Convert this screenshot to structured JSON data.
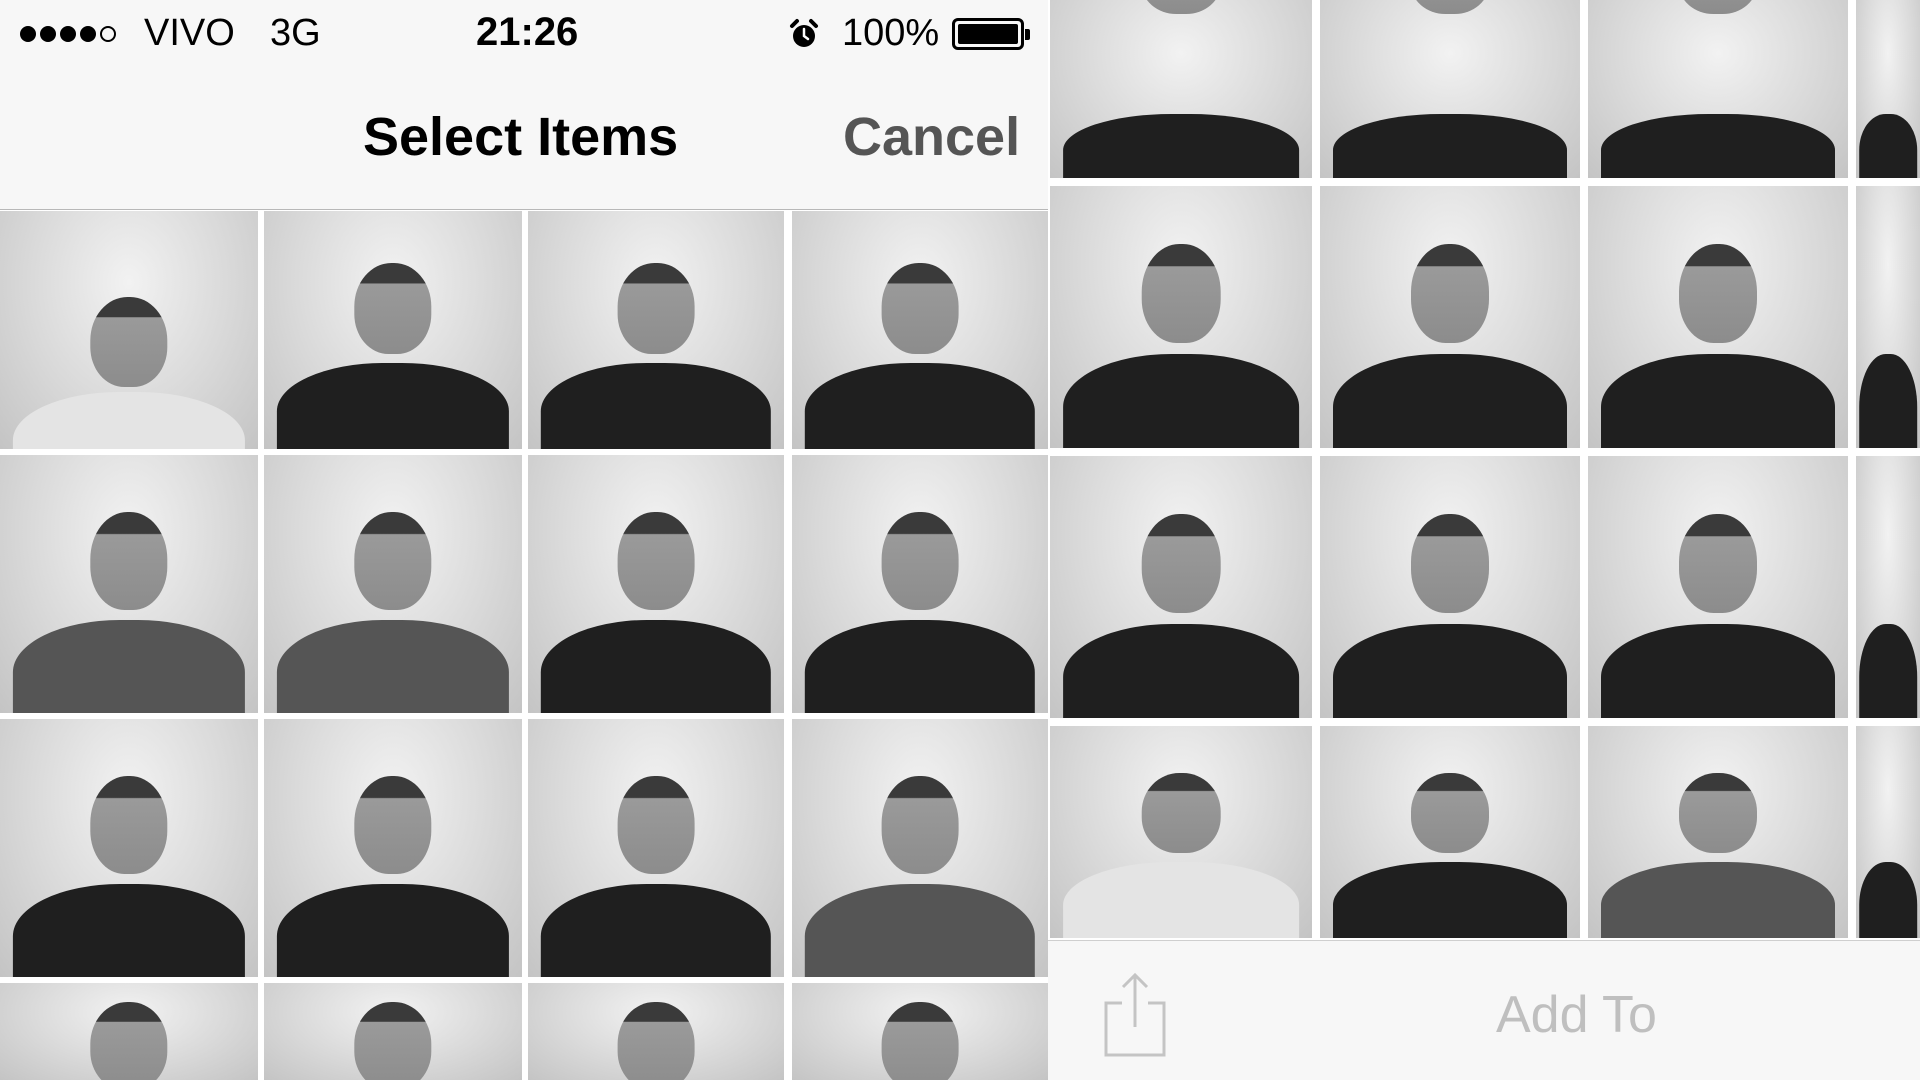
{
  "status_bar": {
    "signal_bars": 4,
    "signal_max": 5,
    "carrier": "VIVO",
    "network": "3G",
    "time": "21:26",
    "alarm_icon": "alarm-clock-icon",
    "battery_percent": "100%",
    "battery_level": 1.0
  },
  "nav_bar": {
    "title": "Select Items",
    "cancel_label": "Cancel"
  },
  "toolbar": {
    "share_icon": "share-icon",
    "add_to_label": "Add To"
  },
  "colors": {
    "bar_background": "#f7f7f7",
    "text": "#000000",
    "cancel_text": "#555555",
    "disabled_text": "#bfbfbf"
  }
}
